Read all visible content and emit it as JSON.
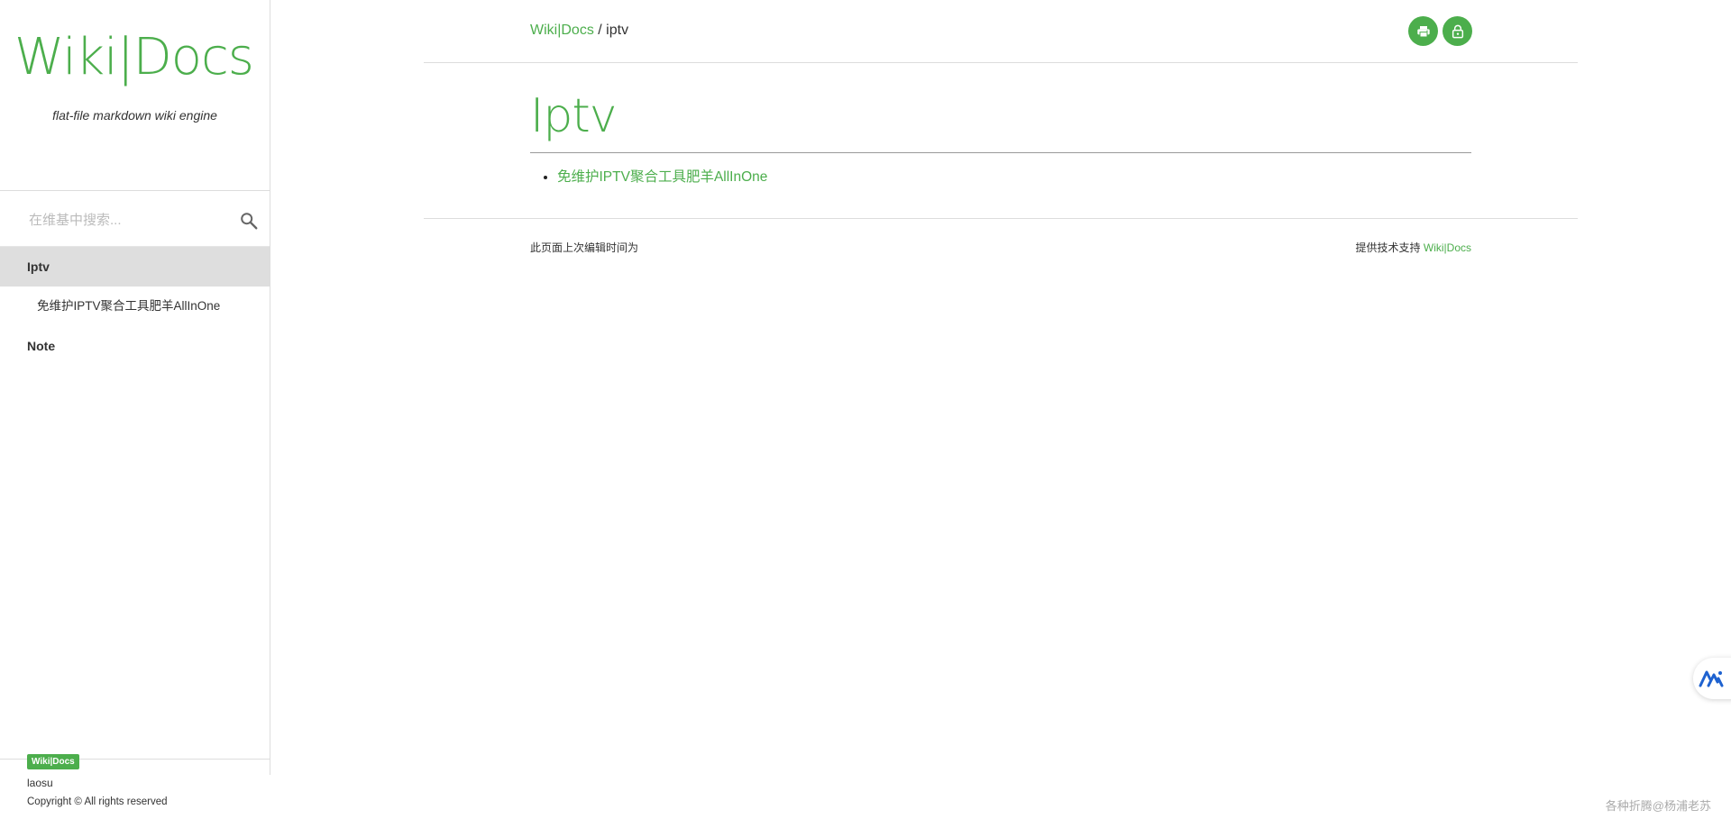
{
  "sidebar": {
    "logo": "Wiki|Docs",
    "tagline": "flat-file markdown wiki engine",
    "search": {
      "placeholder": "在维基中搜索..."
    },
    "nav": [
      {
        "label": "Iptv",
        "active": true
      },
      {
        "label": "免维护IPTV聚合工具肥羊AllInOne"
      },
      {
        "label": "Note"
      }
    ],
    "footer": {
      "badge": "Wiki|Docs",
      "user": "laosu",
      "copyright": "Copyright © All rights reserved"
    }
  },
  "header": {
    "breadcrumb_root": "Wiki|Docs",
    "breadcrumb_separator": " / ",
    "breadcrumb_current": "iptv",
    "buttons": {
      "print": "print-icon",
      "lock": "lock-icon"
    }
  },
  "content": {
    "title": "Iptv",
    "links": [
      "免维护IPTV聚合工具肥羊AllInOne"
    ]
  },
  "footer": {
    "last_edited": "此页面上次编辑时间为",
    "powered_prefix": "提供技术支持 ",
    "powered_link": "Wiki|Docs"
  },
  "watermark": "各种折腾@杨浦老苏",
  "colors": {
    "accent": "#4cae4c",
    "active_nav_bg": "#dedede",
    "text": "#333333"
  }
}
